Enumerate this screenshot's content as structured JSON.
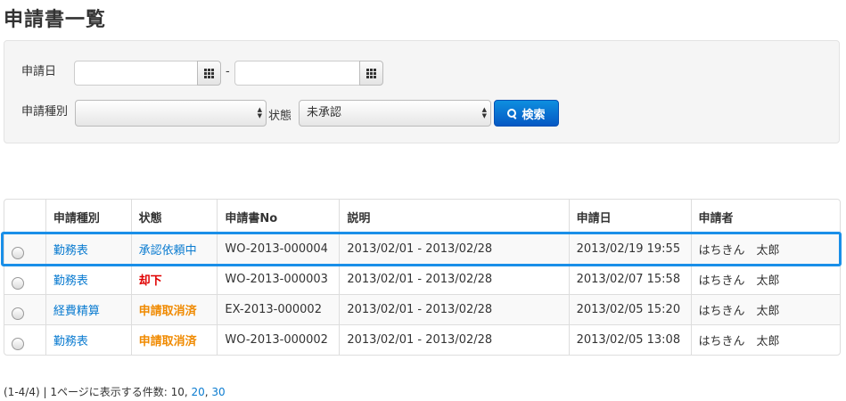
{
  "page": {
    "title": "申請書一覧"
  },
  "filter": {
    "date_label": "申請日",
    "date_from": "",
    "date_to": "",
    "range_separator": "-",
    "type_label": "申請種別",
    "type_value": "",
    "status_label": "状態",
    "status_value": "未承認",
    "search_button": "検索"
  },
  "table": {
    "columns": [
      "",
      "申請種別",
      "状態",
      "申請書No",
      "説明",
      "申請日",
      "申請者"
    ],
    "rows": [
      {
        "type": "勤務表",
        "status": "承認依頼中",
        "no": "WO-2013-000004",
        "desc": "2013/02/01 - 2013/02/28",
        "date": "2013/02/19 19:55",
        "applicant": "はちきん　太郎"
      },
      {
        "type": "勤務表",
        "status": "却下",
        "no": "WO-2013-000003",
        "desc": "2013/02/01 - 2013/02/28",
        "date": "2013/02/07 15:58",
        "applicant": "はちきん　太郎"
      },
      {
        "type": "経費精算",
        "status": "申請取消済",
        "no": "EX-2013-000002",
        "desc": "2013/02/01 - 2013/02/28",
        "date": "2013/02/05 15:20",
        "applicant": "はちきん　太郎"
      },
      {
        "type": "勤務表",
        "status": "申請取消済",
        "no": "WO-2013-000002",
        "desc": "2013/02/01 - 2013/02/28",
        "date": "2013/02/05 13:08",
        "applicant": "はちきん　太郎"
      }
    ]
  },
  "footer": {
    "summary": "(1-4/4) | 1ページに表示する件数: 10, ",
    "size_20": "20",
    "sep": ", ",
    "size_30": "30"
  },
  "colors": {
    "link": "#0a7bd0",
    "status_pending": "#0a7bd0",
    "status_rejected": "#e00000",
    "status_cancelled": "#f08a00",
    "selection_outline": "#1a8fe8",
    "primary_button": "#0558c4"
  }
}
